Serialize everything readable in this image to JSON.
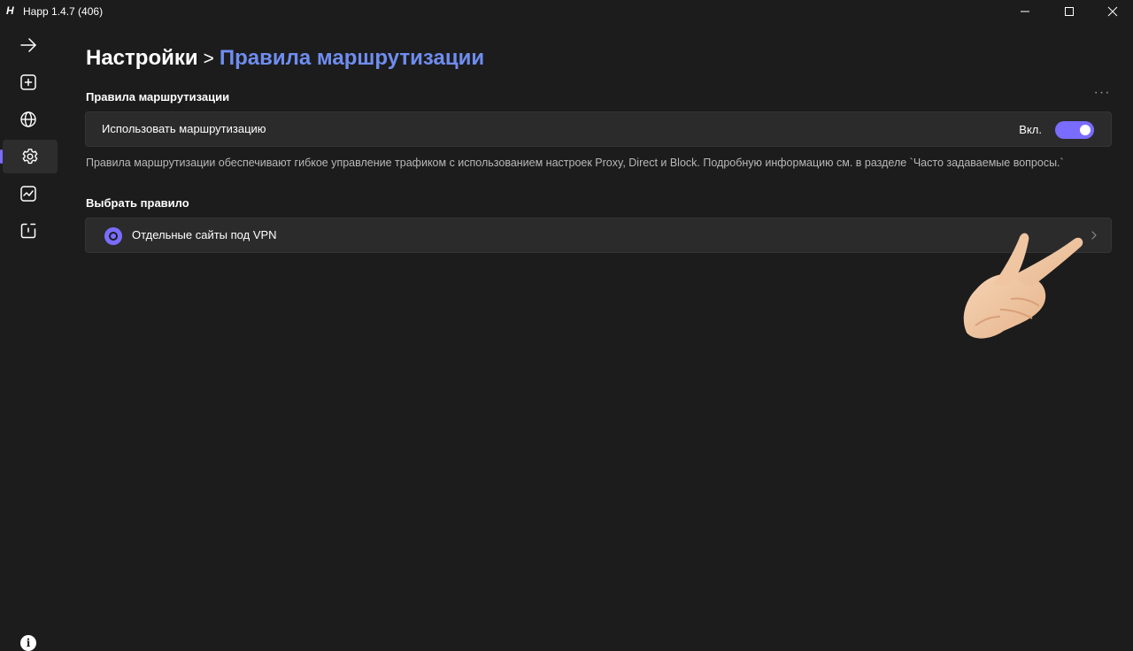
{
  "window": {
    "logo_text": "H",
    "title": "Happ 1.4.7 (406)"
  },
  "sidebar": {
    "items": [
      {
        "icon": "arrow-right-icon",
        "active": false
      },
      {
        "icon": "add-box-icon",
        "active": false
      },
      {
        "icon": "globe-icon",
        "active": false
      },
      {
        "icon": "gear-icon",
        "active": true
      },
      {
        "icon": "activity-chart-icon",
        "active": false
      },
      {
        "icon": "power-timer-icon",
        "active": false
      }
    ],
    "info_label": "i"
  },
  "breadcrumb": {
    "root": "Настройки",
    "separator": ">",
    "current": "Правила маршрутизации"
  },
  "routing": {
    "section_title": "Правила маршрутизации",
    "more_label": "···",
    "use_routing_label": "Использовать маршрутизацию",
    "toggle_state": "Вкл.",
    "toggle_on": true,
    "description": "Правила маршрутизации обеспечивают гибкое управление трафиком с использованием настроек Proxy, Direct и Block. Подробную информацию см. в разделе `Часто задаваемые вопросы.`"
  },
  "rule": {
    "section_title": "Выбрать правило",
    "selected_label": "Отдельные сайты под VPN"
  },
  "colors": {
    "background": "#1c1c1c",
    "card": "#2b2b2b",
    "accent": "#7a6cff",
    "link": "#6f8df0"
  }
}
